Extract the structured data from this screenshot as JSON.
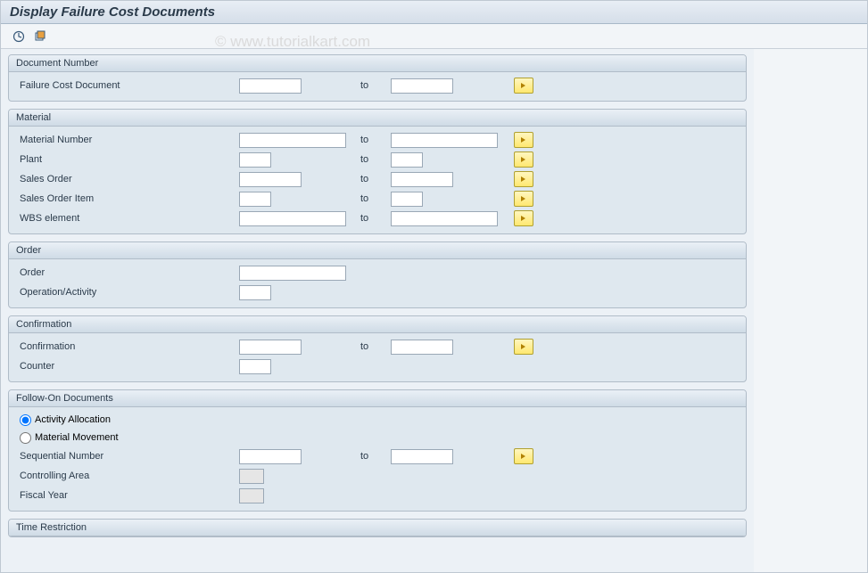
{
  "title": "Display Failure Cost Documents",
  "watermark": "© www.tutorialkart.com",
  "to_label": "to",
  "groups": {
    "doc_number": {
      "title": "Document Number",
      "failure_cost": "Failure Cost Document"
    },
    "material": {
      "title": "Material",
      "material_number": "Material Number",
      "plant": "Plant",
      "sales_order": "Sales Order",
      "sales_order_item": "Sales Order Item",
      "wbs_element": "WBS element"
    },
    "order": {
      "title": "Order",
      "order": "Order",
      "operation": "Operation/Activity"
    },
    "confirmation": {
      "title": "Confirmation",
      "confirmation": "Confirmation",
      "counter": "Counter"
    },
    "followon": {
      "title": "Follow-On Documents",
      "activity_allocation": "Activity Allocation",
      "material_movement": "Material Movement",
      "sequential_number": "Sequential Number",
      "controlling_area": "Controlling Area",
      "fiscal_year": "Fiscal Year"
    },
    "time": {
      "title": "Time Restriction"
    }
  }
}
